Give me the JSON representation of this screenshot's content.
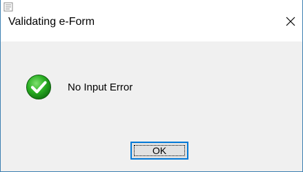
{
  "window": {
    "title": "Validating e-Form",
    "close_glyph": "✕",
    "app_icon": "app-icon"
  },
  "content": {
    "status_icon": "check-icon",
    "message": "No Input Error"
  },
  "buttons": {
    "ok_label": "OK"
  },
  "colors": {
    "border": "#3c7fb1",
    "client_background": "#f0f0f0",
    "button_focus": "#0078d7",
    "check_green": "#2bb024"
  }
}
